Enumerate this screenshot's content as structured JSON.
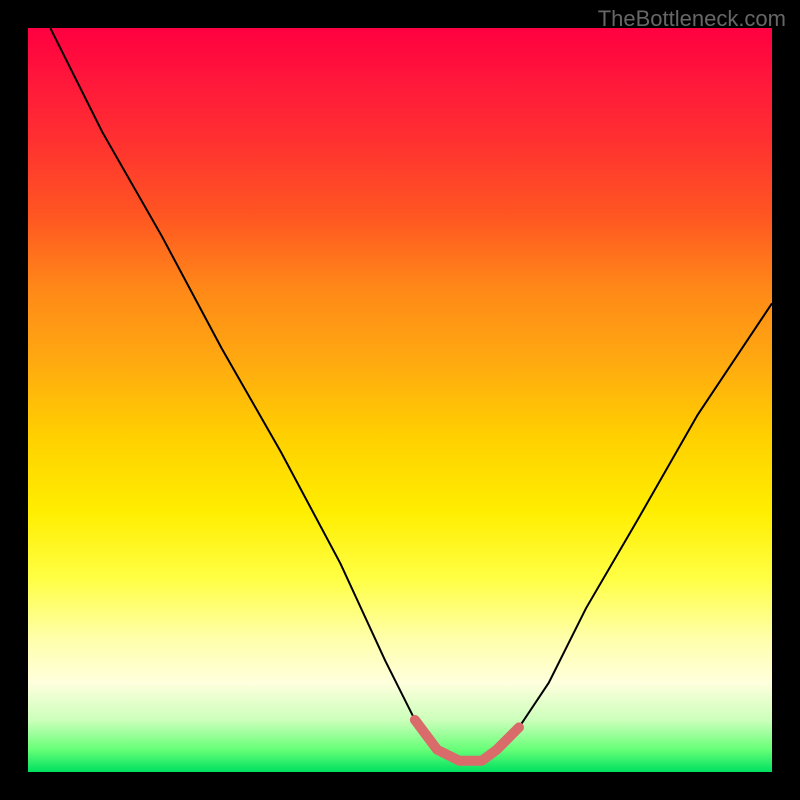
{
  "watermark": "TheBottleneck.com",
  "chart_data": {
    "type": "line",
    "title": "",
    "xlabel": "",
    "ylabel": "",
    "xlim": [
      0,
      100
    ],
    "ylim": [
      0,
      100
    ],
    "series": [
      {
        "name": "bottleneck-curve",
        "x": [
          3,
          10,
          18,
          26,
          34,
          42,
          48,
          52,
          55,
          58,
          61,
          63,
          66,
          70,
          75,
          82,
          90,
          100
        ],
        "values": [
          100,
          86,
          72,
          57,
          43,
          28,
          15,
          7,
          3,
          1.5,
          1.5,
          3,
          6,
          12,
          22,
          34,
          48,
          63
        ]
      }
    ],
    "highlight": {
      "name": "optimal-range",
      "color": "#d96b6b",
      "x": [
        52,
        55,
        58,
        61,
        63,
        66
      ],
      "values": [
        7,
        3,
        1.5,
        1.5,
        3,
        6
      ]
    },
    "gradient_stops": [
      {
        "pos": 0.0,
        "color": "#ff0040"
      },
      {
        "pos": 0.25,
        "color": "#ff5522"
      },
      {
        "pos": 0.55,
        "color": "#ffd000"
      },
      {
        "pos": 0.82,
        "color": "#ffffaa"
      },
      {
        "pos": 1.0,
        "color": "#00e060"
      }
    ]
  }
}
